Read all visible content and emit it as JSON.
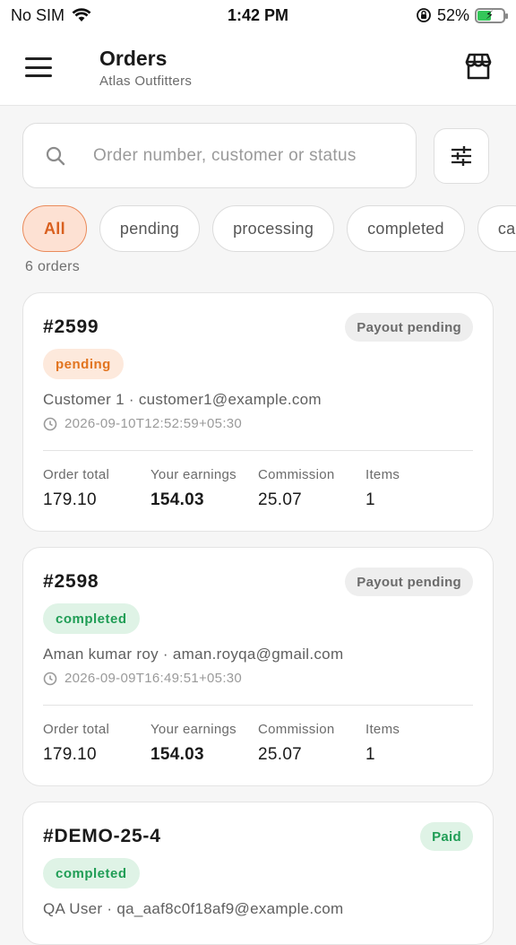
{
  "status_bar": {
    "carrier": "No SIM",
    "time": "1:42 PM",
    "battery": "52%",
    "battery_level": 0.52
  },
  "header": {
    "title": "Orders",
    "subtitle": "Atlas Outfitters"
  },
  "search": {
    "placeholder": "Order number, customer or status",
    "value": ""
  },
  "filters": [
    {
      "label": "All",
      "active": true
    },
    {
      "label": "pending",
      "active": false
    },
    {
      "label": "processing",
      "active": false
    },
    {
      "label": "completed",
      "active": false
    },
    {
      "label": "ca",
      "active": false
    }
  ],
  "order_count": "6 orders",
  "stat_labels": {
    "total": "Order total",
    "earnings": "Your earnings",
    "commission": "Commission",
    "items": "Items"
  },
  "orders": [
    {
      "id": "#2599",
      "payout": "Payout pending",
      "status": "pending",
      "customer": "Customer 1 · customer1@example.com",
      "date": "2026-09-10T12:52:59+05:30",
      "total": "179.10",
      "earnings": "154.03",
      "commission": "25.07",
      "items": "1"
    },
    {
      "id": "#2598",
      "payout": "Payout pending",
      "status": "completed",
      "customer": "Aman kumar roy · aman.royqa@gmail.com",
      "date": "2026-09-09T16:49:51+05:30",
      "total": "179.10",
      "earnings": "154.03",
      "commission": "25.07",
      "items": "1"
    },
    {
      "id": "#DEMO-25-4",
      "payout": "Paid",
      "status": "completed",
      "customer": "QA User · qa_aaf8c0f18af9@example.com"
    }
  ],
  "colors": {
    "accent": "#d9601f",
    "accent_bg": "#fde1d3",
    "success": "#1f9d55",
    "success_bg": "#dff3e6"
  }
}
